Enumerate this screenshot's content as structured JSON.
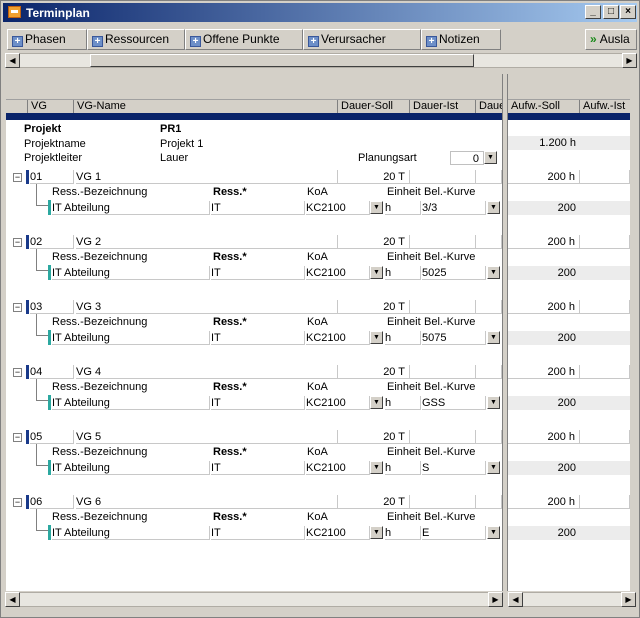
{
  "window": {
    "title": "Terminplan"
  },
  "toolbar": {
    "phasen": "Phasen",
    "ressourcen": "Ressourcen",
    "offene": "Offene Punkte",
    "verursacher": "Verursacher",
    "notizen": "Notizen",
    "auslastung": "Ausla"
  },
  "columns_left": [
    "VG",
    "VG-Name",
    "Dauer-Soll",
    "Dauer-Ist",
    "Dauer"
  ],
  "columns_right": [
    "Aufw.-Soll",
    "Aufw.-Ist"
  ],
  "project": {
    "label": "Projekt",
    "id": "PR1",
    "name_label": "Projektname",
    "name": "Projekt 1",
    "leader_label": "Projektleiter",
    "leader": "Lauer",
    "planungsart_label": "Planungsart",
    "planungsart": "0",
    "aufwand": "1.200 h"
  },
  "res_header": {
    "bez": "Ress.-Bezeichnung",
    "ress": "Ress.*",
    "koa": "KoA",
    "einheit": "Einheit",
    "kurve": "Bel.-Kurve"
  },
  "groups": [
    {
      "vg": "01",
      "name": "VG 1",
      "dauer": "20 T",
      "aufw": "200 h",
      "res": {
        "bez": "IT Abteilung",
        "ress": "IT",
        "koa": "KC2100",
        "einheit": "h",
        "kurve": "3/3",
        "aufw": "200"
      }
    },
    {
      "vg": "02",
      "name": "VG 2",
      "dauer": "20 T",
      "aufw": "200 h",
      "res": {
        "bez": "IT Abteilung",
        "ress": "IT",
        "koa": "KC2100",
        "einheit": "h",
        "kurve": "5025",
        "aufw": "200"
      }
    },
    {
      "vg": "03",
      "name": "VG 3",
      "dauer": "20 T",
      "aufw": "200 h",
      "res": {
        "bez": "IT Abteilung",
        "ress": "IT",
        "koa": "KC2100",
        "einheit": "h",
        "kurve": "5075",
        "aufw": "200"
      }
    },
    {
      "vg": "04",
      "name": "VG 4",
      "dauer": "20 T",
      "aufw": "200 h",
      "res": {
        "bez": "IT Abteilung",
        "ress": "IT",
        "koa": "KC2100",
        "einheit": "h",
        "kurve": "GSS",
        "aufw": "200"
      }
    },
    {
      "vg": "05",
      "name": "VG 5",
      "dauer": "20 T",
      "aufw": "200 h",
      "res": {
        "bez": "IT Abteilung",
        "ress": "IT",
        "koa": "KC2100",
        "einheit": "h",
        "kurve": "S",
        "aufw": "200"
      }
    },
    {
      "vg": "06",
      "name": "VG 6",
      "dauer": "20 T",
      "aufw": "200 h",
      "res": {
        "bez": "IT Abteilung",
        "ress": "IT",
        "koa": "KC2100",
        "einheit": "h",
        "kurve": "E",
        "aufw": "200"
      }
    }
  ],
  "colors": {
    "title_start": "#0a246a",
    "title_end": "#a6caf0",
    "header_line": "#0a246a",
    "tree_bar": "#1a3a8a",
    "res_bar": "#2ca8a0"
  },
  "icons": {
    "title": "calendar-icon",
    "tool": "plus-icon",
    "auslastung": "arrow-right-icon",
    "min": "minimize-icon",
    "max": "maximize-icon",
    "close": "close-icon"
  }
}
